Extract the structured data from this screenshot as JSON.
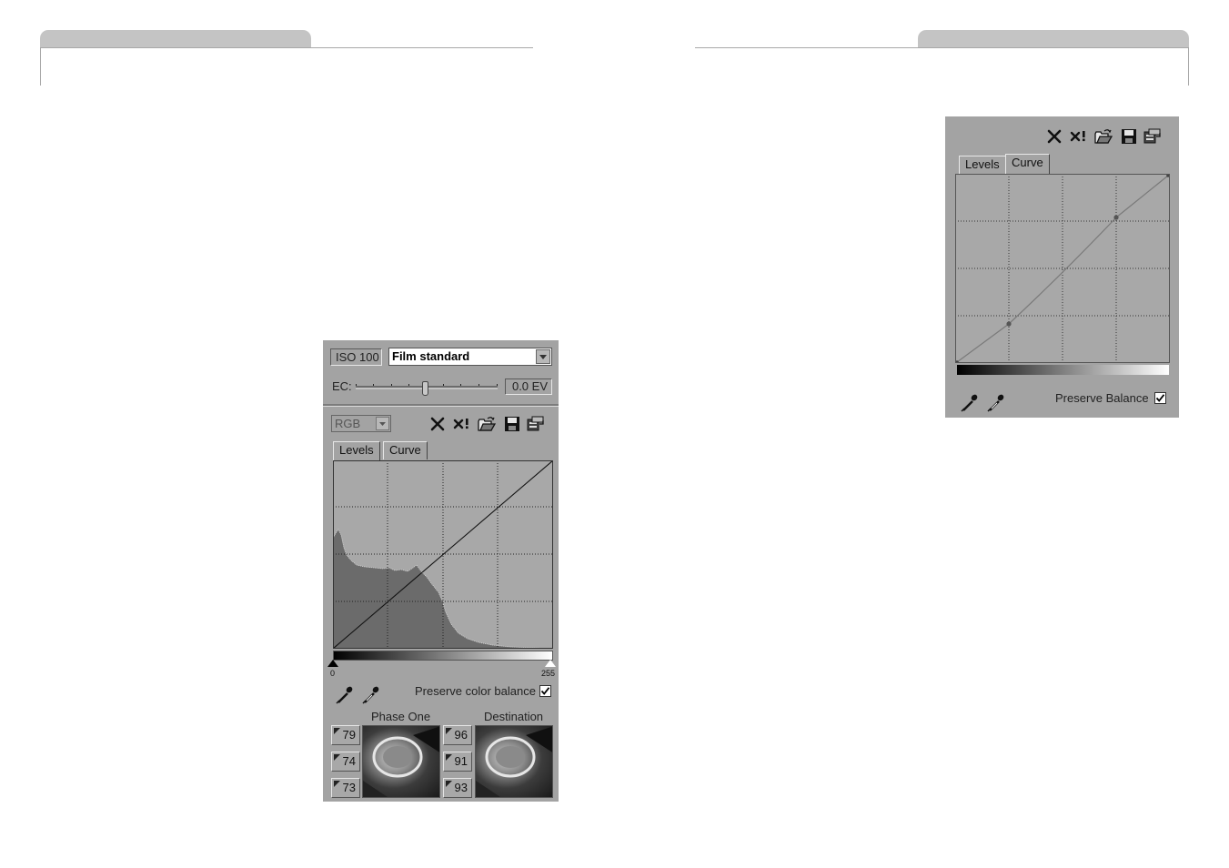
{
  "left_panel": {
    "iso_label": "ISO 100",
    "film_curve": "Film standard",
    "ec_label": "EC:",
    "ec_value": "0.0 EV",
    "channel": "RGB",
    "tabs": [
      {
        "label": "Levels"
      },
      {
        "label": "Curve"
      }
    ],
    "active_tab": "Levels",
    "level_min": "0",
    "level_max": "255",
    "preserve_label": "Preserve color balance",
    "preserve_checked": true,
    "phase_one_label": "Phase One",
    "destination_label": "Destination",
    "phase_one_values": [
      "79",
      "74",
      "73"
    ],
    "destination_values": [
      "96",
      "91",
      "93"
    ]
  },
  "right_panel": {
    "tabs": [
      {
        "label": "Levels"
      },
      {
        "label": "Curve"
      }
    ],
    "active_tab": "Curve",
    "preserve_label": "Preserve Balance",
    "preserve_checked": true
  },
  "toolbar_icons": [
    "reset-icon",
    "reset-all-icon",
    "open-folder-icon",
    "save-icon",
    "copy-settings-icon"
  ],
  "colors": {
    "panel": "#a3a3a3",
    "page_tab": "#c4c4c4"
  }
}
